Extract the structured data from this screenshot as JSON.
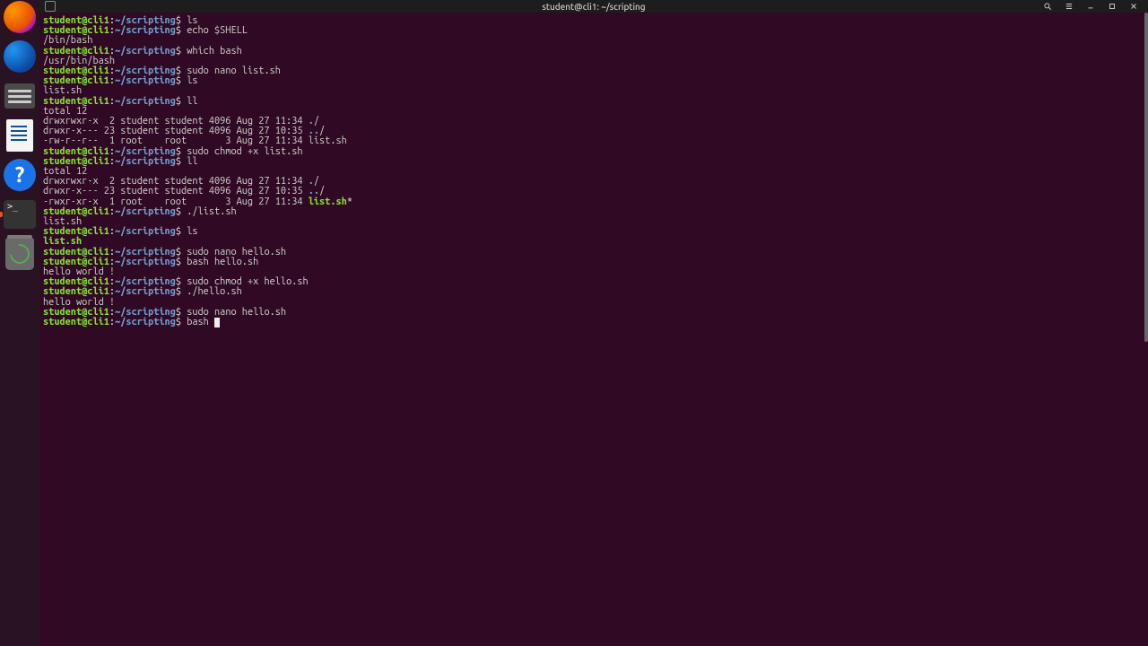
{
  "window": {
    "title": "student@cli1: ~/scripting"
  },
  "prompt": {
    "user": "student@cli1",
    "sep": ":",
    "path": "~/scripting",
    "symbol": "$"
  },
  "dock_icons": [
    "firefox",
    "thunderbird",
    "files",
    "writer",
    "help",
    "terminal",
    "trash"
  ],
  "titlebar_buttons": [
    "search",
    "menu",
    "minimize",
    "maximize",
    "close"
  ],
  "session": [
    {
      "t": "cmd",
      "text": "ls"
    },
    {
      "t": "cmd",
      "text": "echo $SHELL"
    },
    {
      "t": "out",
      "text": "/bin/bash"
    },
    {
      "t": "cmd",
      "text": "which bash"
    },
    {
      "t": "out",
      "text": "/usr/bin/bash"
    },
    {
      "t": "cmd",
      "text": "sudo nano list.sh"
    },
    {
      "t": "cmd",
      "text": "ls"
    },
    {
      "t": "out",
      "text": "list.sh"
    },
    {
      "t": "cmd",
      "text": "ll"
    },
    {
      "t": "out",
      "text": "total 12"
    },
    {
      "t": "ll",
      "perm": "drwxrwxr-x",
      "lnk": "2",
      "own": "student",
      "grp": "student",
      "size": "4096",
      "date": "Aug 27 11:34",
      "name": ".",
      "suffix": "/",
      "cls": "dir"
    },
    {
      "t": "ll",
      "perm": "drwxr-x---",
      "lnk": "23",
      "own": "student",
      "grp": "student",
      "size": "4096",
      "date": "Aug 27 10:35",
      "name": "..",
      "suffix": "/",
      "cls": "dir"
    },
    {
      "t": "ll",
      "perm": "-rw-r--r--",
      "lnk": "1",
      "own": "root",
      "grp": "root",
      "size": "3",
      "date": "Aug 27 11:34",
      "name": "list.sh",
      "suffix": "",
      "cls": "txt"
    },
    {
      "t": "cmd",
      "text": "sudo chmod +x list.sh"
    },
    {
      "t": "cmd",
      "text": "ll"
    },
    {
      "t": "out",
      "text": "total 12"
    },
    {
      "t": "ll",
      "perm": "drwxrwxr-x",
      "lnk": "2",
      "own": "student",
      "grp": "student",
      "size": "4096",
      "date": "Aug 27 11:34",
      "name": ".",
      "suffix": "/",
      "cls": "dir"
    },
    {
      "t": "ll",
      "perm": "drwxr-x---",
      "lnk": "23",
      "own": "student",
      "grp": "student",
      "size": "4096",
      "date": "Aug 27 10:35",
      "name": "..",
      "suffix": "/",
      "cls": "dir"
    },
    {
      "t": "ll",
      "perm": "-rwxr-xr-x",
      "lnk": "1",
      "own": "root",
      "grp": "root",
      "size": "3",
      "date": "Aug 27 11:34",
      "name": "list.sh",
      "suffix": "*",
      "cls": "exec"
    },
    {
      "t": "cmd",
      "text": "./list.sh"
    },
    {
      "t": "out",
      "text": "list.sh"
    },
    {
      "t": "cmd",
      "text": "ls"
    },
    {
      "t": "out",
      "text": "list.sh",
      "cls": "exec"
    },
    {
      "t": "cmd",
      "text": "sudo nano hello.sh"
    },
    {
      "t": "cmd",
      "text": "bash hello.sh"
    },
    {
      "t": "out",
      "text": "hello world !"
    },
    {
      "t": "cmd",
      "text": "sudo chmod +x hello.sh"
    },
    {
      "t": "cmd",
      "text": "./hello.sh"
    },
    {
      "t": "out",
      "text": "hello world !"
    },
    {
      "t": "cmd",
      "text": "sudo nano hello.sh"
    },
    {
      "t": "cmd",
      "text": "bash ",
      "cursor": true
    }
  ]
}
